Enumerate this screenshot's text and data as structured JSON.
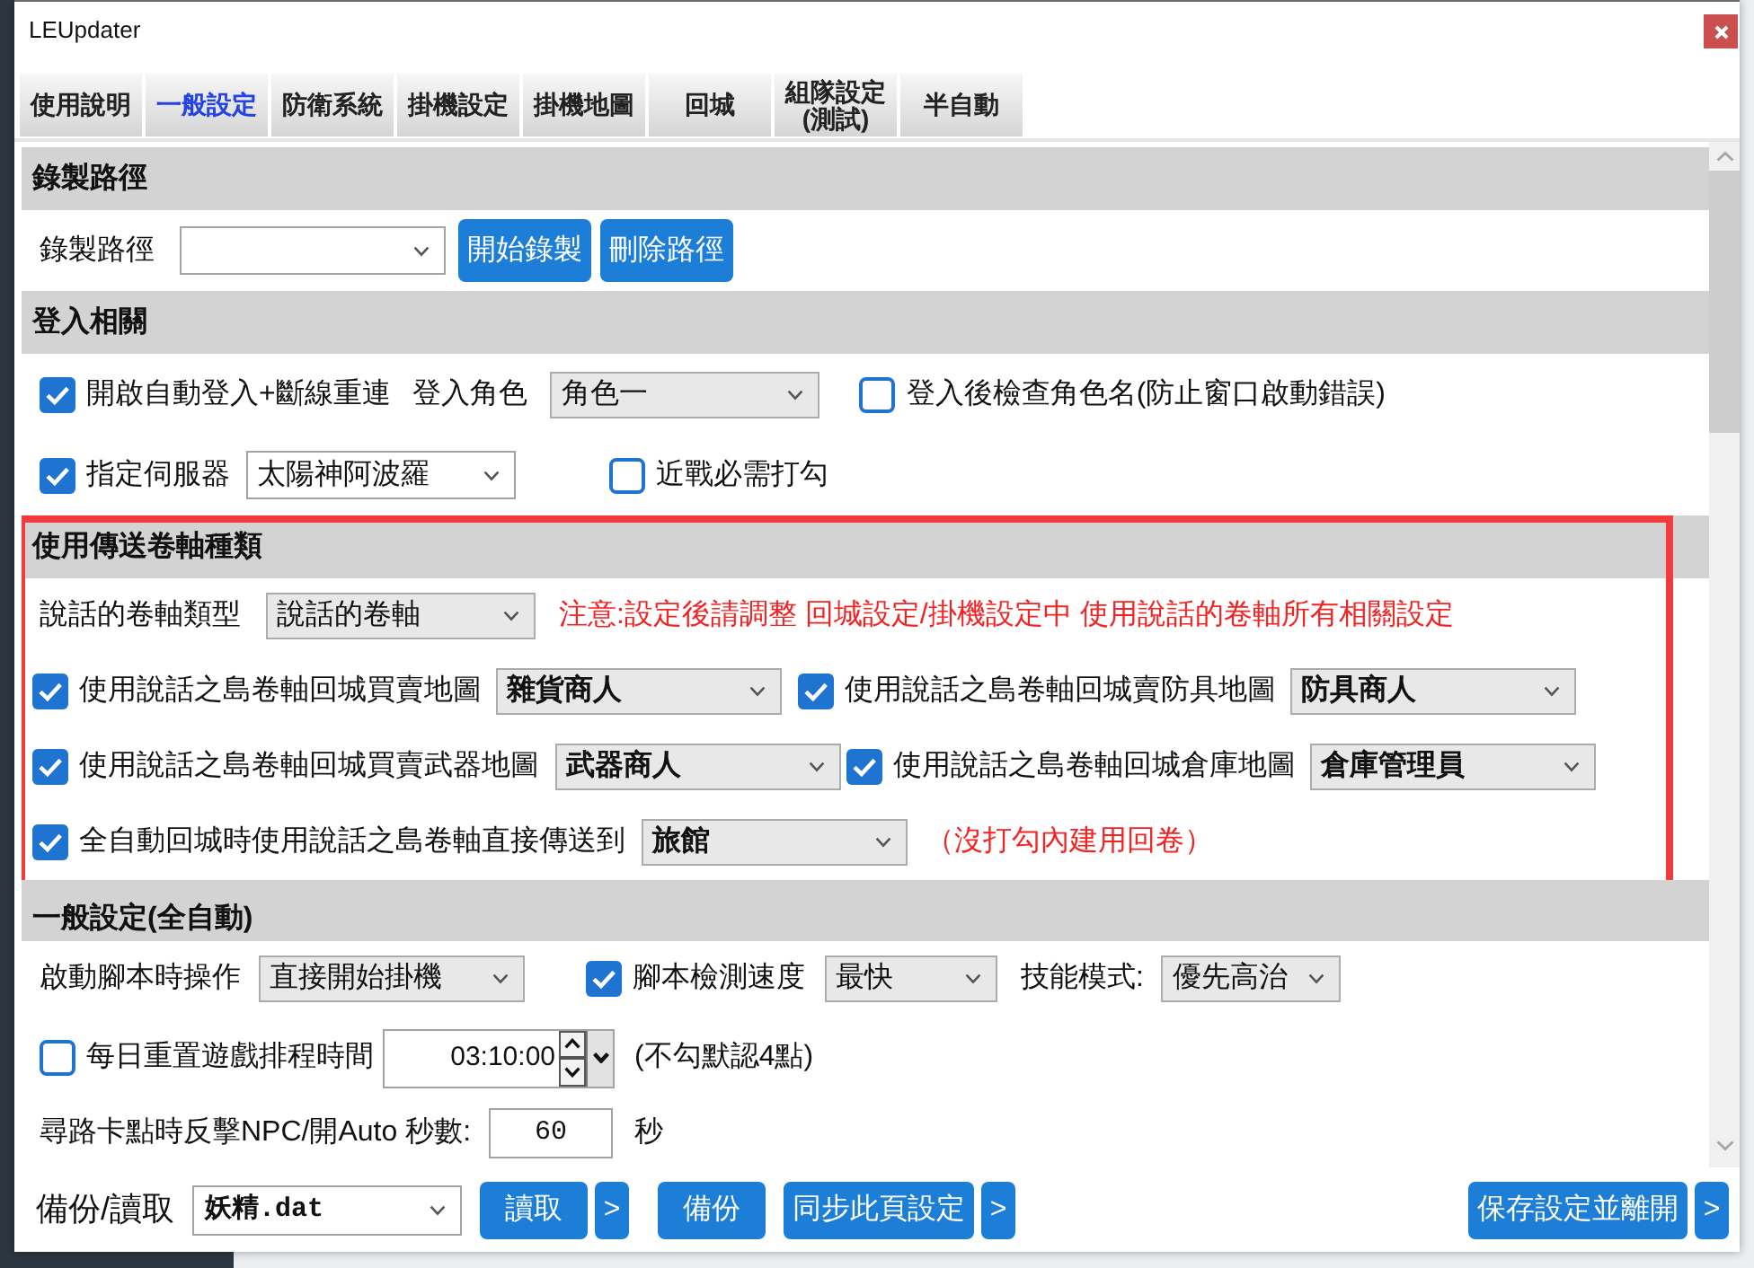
{
  "window": {
    "title": "LEUpdater"
  },
  "tabs": [
    {
      "label": "使用說明",
      "selected": false
    },
    {
      "label": "一般設定",
      "selected": true
    },
    {
      "label": "防衛系統",
      "selected": false
    },
    {
      "label": "掛機設定",
      "selected": false
    },
    {
      "label": "掛機地圖",
      "selected": false
    },
    {
      "label": "回城",
      "selected": false
    },
    {
      "label": "組隊設定\n(測試)",
      "selected": false
    },
    {
      "label": "半自動",
      "selected": false
    }
  ],
  "sections": [
    {
      "title": "錄製路徑",
      "highlighted": false,
      "rows": [
        {
          "items": [
            {
              "kind": "label",
              "text": "錄製路徑"
            },
            {
              "kind": "combo"
            },
            {
              "kind": "button",
              "label": "開始錄製"
            },
            {
              "kind": "button",
              "label": "刪除路徑"
            }
          ]
        }
      ]
    },
    {
      "title": "登入相關",
      "highlighted": false,
      "rows": [
        {
          "items": [
            {
              "kind": "checkbox",
              "label": "開啟自動登入+斷線重連",
              "checked": true
            },
            {
              "kind": "label",
              "text": "登入角色"
            },
            {
              "kind": "select",
              "value": "角色一"
            },
            {
              "kind": "checkbox",
              "label": "登入後檢查角色名(防止窗口啟動錯誤)",
              "checked": false
            }
          ]
        },
        {
          "items": [
            {
              "kind": "checkbox",
              "label": "指定伺服器",
              "checked": true
            },
            {
              "kind": "combo",
              "value": "太陽神阿波羅"
            },
            {
              "kind": "checkbox",
              "label": "近戰必需打勾",
              "checked": false
            }
          ]
        }
      ]
    },
    {
      "title": "使用傳送卷軸種類",
      "highlighted": true,
      "rows": [
        {
          "items": [
            {
              "kind": "label",
              "text": "說話的卷軸類型"
            },
            {
              "kind": "select",
              "value": "說話的卷軸"
            },
            {
              "kind": "note",
              "text": "注意:設定後請調整 回城設定/掛機設定中 使用說話的卷軸所有相關設定"
            }
          ]
        },
        {
          "items": [
            {
              "kind": "checkbox",
              "label": "使用說話之島卷軸回城買賣地圖",
              "checked": true
            },
            {
              "kind": "target",
              "value": "雜貨商人"
            },
            {
              "kind": "checkbox",
              "label": "使用說話之島卷軸回城賣防具地圖",
              "checked": true
            },
            {
              "kind": "target",
              "value": "防具商人"
            }
          ]
        },
        {
          "items": [
            {
              "kind": "checkbox",
              "label": "使用說話之島卷軸回城買賣武器地圖",
              "checked": true
            },
            {
              "kind": "target",
              "value": "武器商人"
            },
            {
              "kind": "checkbox",
              "label": "使用說話之島卷軸回城倉庫地圖",
              "checked": true
            },
            {
              "kind": "target",
              "value": "倉庫管理員"
            }
          ]
        },
        {
          "items": [
            {
              "kind": "checkbox",
              "label": "全自動回城時使用說話之島卷軸直接傳送到",
              "checked": true
            },
            {
              "kind": "target",
              "value": "旅館"
            },
            {
              "kind": "note",
              "text": "（沒打勾內建用回卷）"
            }
          ]
        }
      ]
    },
    {
      "title": "一般設定(全自動)",
      "highlighted": false,
      "rows": [
        {
          "items": [
            {
              "kind": "label",
              "text": "啟動腳本時操作"
            },
            {
              "kind": "select",
              "value": "直接開始掛機"
            },
            {
              "kind": "checkbox",
              "label": "腳本檢測速度",
              "checked": true
            },
            {
              "kind": "select",
              "value": "最快"
            },
            {
              "kind": "label",
              "text": "技能模式:"
            },
            {
              "kind": "select",
              "value": "優先高治"
            }
          ]
        },
        {
          "items": [
            {
              "kind": "checkbox",
              "label": "每日重置遊戲排程時間",
              "checked": false
            },
            {
              "kind": "time",
              "value": "03:10:00"
            },
            {
              "kind": "label",
              "text": "(不勾默認4點)"
            }
          ]
        },
        {
          "items": [
            {
              "kind": "label",
              "text": "尋路卡點時反擊NPC/開Auto 秒數:"
            },
            {
              "kind": "number",
              "value": "60"
            },
            {
              "kind": "label",
              "text": "秒"
            }
          ]
        }
      ]
    }
  ],
  "footer": {
    "label": "備份/讀取",
    "file": {
      "value": "妖精.dat"
    },
    "buttons": [
      {
        "kind": "main",
        "label": "讀取"
      },
      {
        "kind": "more",
        "label": ">"
      },
      {
        "kind": "main",
        "label": "備份"
      },
      {
        "kind": "main",
        "label": "同步此頁設定"
      },
      {
        "kind": "more",
        "label": ">"
      }
    ],
    "end_buttons": [
      {
        "kind": "main",
        "label": "保存設定並離開"
      },
      {
        "kind": "more",
        "label": ">"
      }
    ]
  }
}
